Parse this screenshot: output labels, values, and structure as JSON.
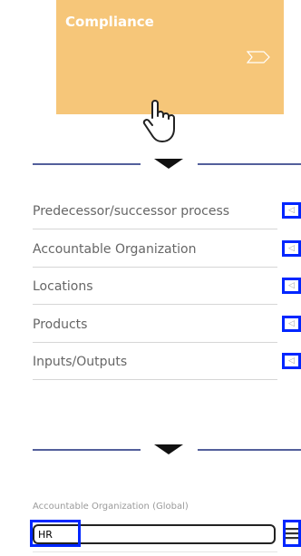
{
  "tile": {
    "title": "Compliance",
    "icon": "chevron-tag-icon",
    "color": "#f6c679"
  },
  "cursor": {
    "icon": "hand-pointer-icon"
  },
  "separator": {
    "icon": "caret-down-icon",
    "line_color": "#1a2a7a"
  },
  "rows": [
    {
      "label": "Predecessor/successor process"
    },
    {
      "label": "Accountable Organization"
    },
    {
      "label": "Locations"
    },
    {
      "label": "Products"
    },
    {
      "label": "Inputs/Outputs"
    }
  ],
  "row_button": {
    "glyph": "◁",
    "icon": "collapse-arrow-icon",
    "highlight_color": "#0026ff"
  },
  "field": {
    "label": "Accountable Organization (Global)",
    "value": "HR",
    "menu_icon": "hamburger-menu-icon"
  }
}
